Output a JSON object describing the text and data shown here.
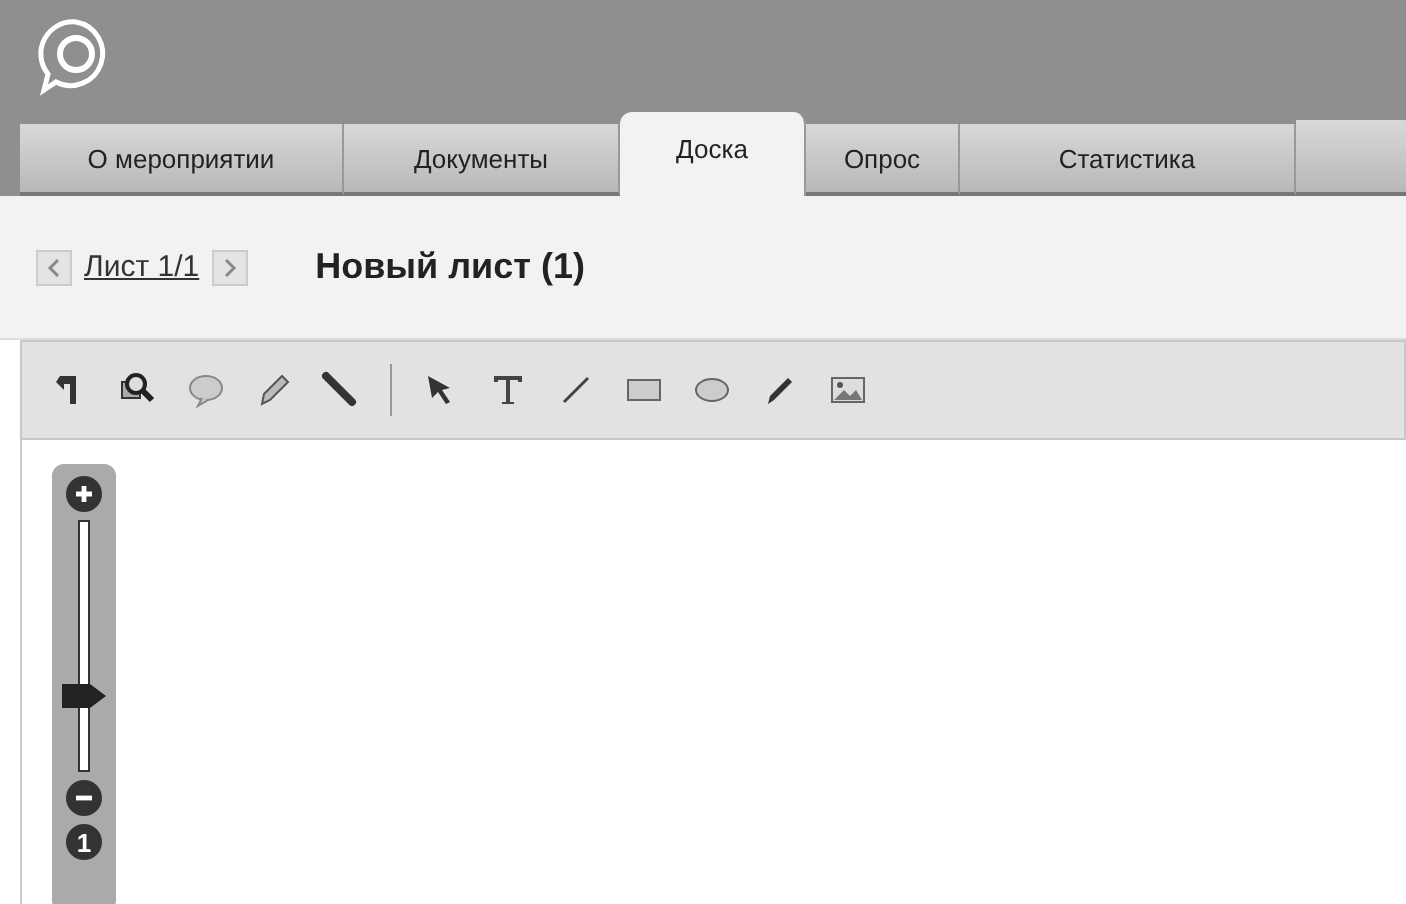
{
  "tabs": [
    {
      "label": "О мероприятии",
      "selected": false
    },
    {
      "label": "Документы",
      "selected": false
    },
    {
      "label": "Доска",
      "selected": true
    },
    {
      "label": "Опрос",
      "selected": false
    },
    {
      "label": "Статистика",
      "selected": false
    }
  ],
  "sheet_nav": {
    "page": "Лист 1/1",
    "title": "Новый лист (1)"
  },
  "zoom": {
    "level": 0.3,
    "reset": "1"
  }
}
